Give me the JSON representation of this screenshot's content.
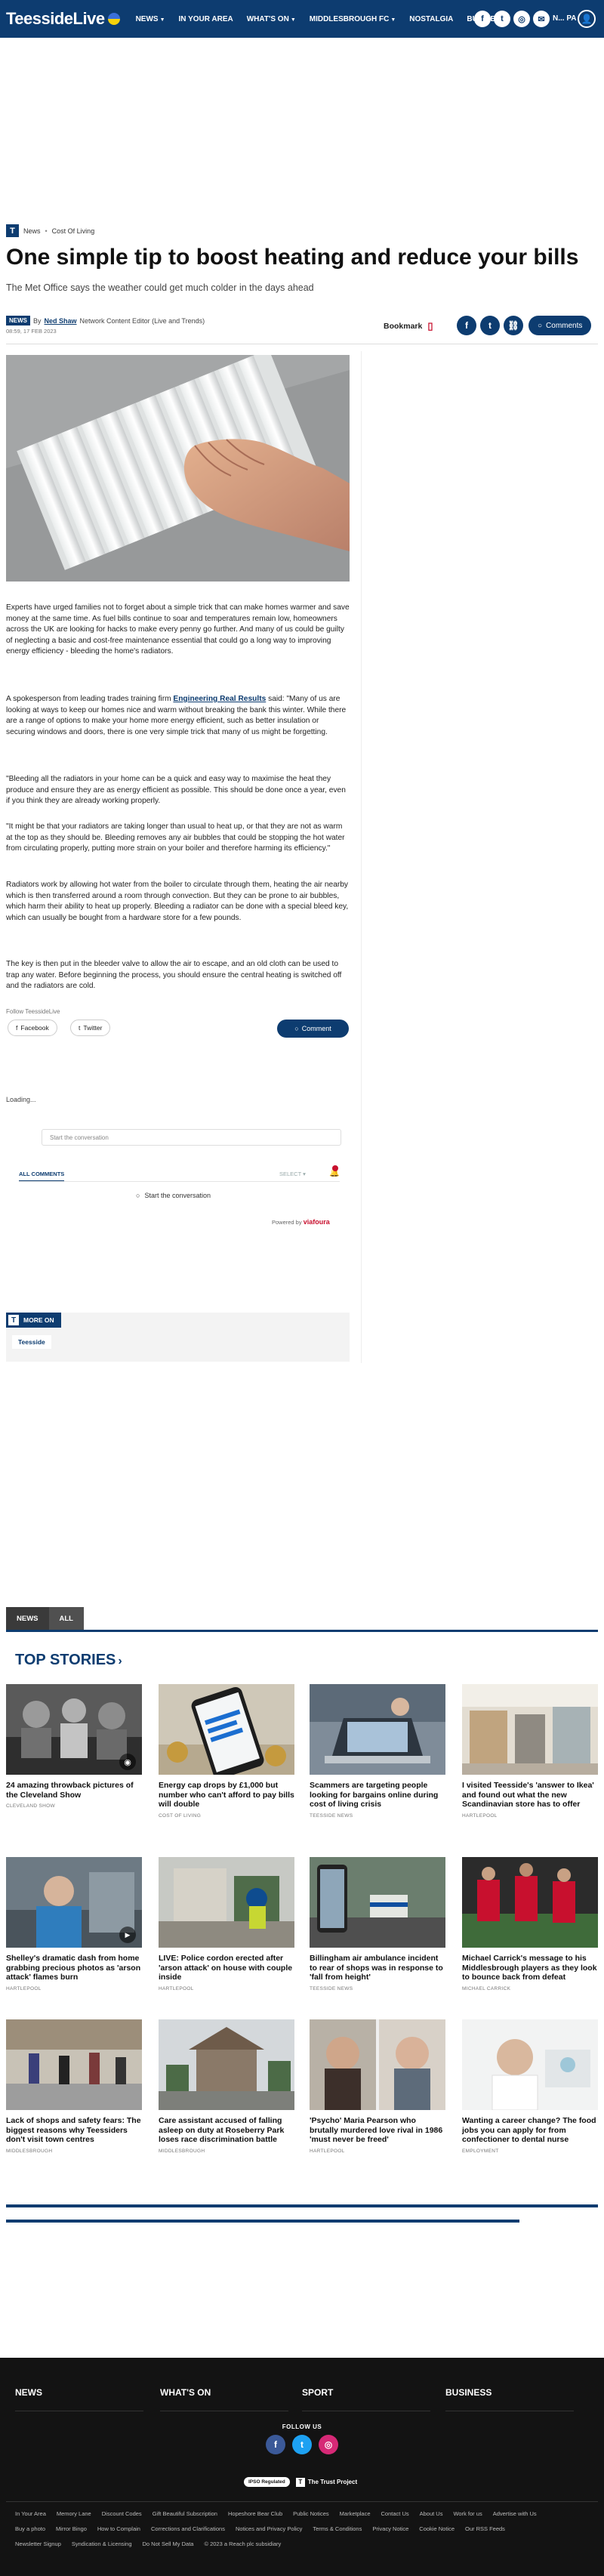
{
  "header": {
    "logo": "TeessideLive",
    "nav": [
      {
        "label": "NEWS",
        "caret": true
      },
      {
        "label": "IN YOUR AREA",
        "caret": false
      },
      {
        "label": "WHAT'S ON",
        "caret": true
      },
      {
        "label": "MIDDLESBROUGH FC",
        "caret": true
      },
      {
        "label": "NOSTALGIA",
        "caret": false
      },
      {
        "label": "BUSINE",
        "caret": false
      }
    ],
    "tail_text": "N... PA",
    "colors": {
      "brand": "#0d3c70",
      "accent": "#c8102e"
    }
  },
  "breadcrumb": {
    "badge": "T",
    "items": [
      "News",
      "Cost Of Living"
    ]
  },
  "article": {
    "title": "One simple tip to boost heating and reduce your bills",
    "subtitle": "The Met Office says the weather could get much colder in the days ahead",
    "byline_tag": "NEWS",
    "by": "By",
    "author": "Ned Shaw",
    "author_role": "Network Content Editor (Live and Trends)",
    "date": "08:59, 17 FEB 2023",
    "bookmark": "Bookmark",
    "comments_label": "Comments",
    "p1": "Experts have urged families not to forget about a simple trick that can make homes warmer and save money at the same time. As fuel bills continue to soar and temperatures remain low, homeowners across the UK are looking for hacks to make every penny go further. And many of us could be guilty of neglecting a basic and cost-free maintenance essential that could go a long way to improving energy efficiency - bleeding the home's radiators.",
    "p2_pre": "A spokesperson from leading trades training firm ",
    "p2_link": "Engineering Real Results",
    "p2_post": " said: \"Many of us are looking at ways to keep our homes nice and warm without breaking the bank this winter. While there are a range of options to make your home more energy efficient, such as better insulation or securing windows and doors, there is one very simple trick that many of us might be forgetting.",
    "p3": "\"Bleeding all the radiators in your home can be a quick and easy way to maximise the heat they produce and ensure they are as energy efficient as possible. This should be done once a year, even if you think they are already working properly.",
    "p4": "\"It might be that your radiators are taking longer than usual to heat up, or that they are not as warm at the top as they should be. Bleeding removes any air bubbles that could be stopping the hot water from circulating properly, putting more strain on your boiler and therefore harming its efficiency.\"",
    "p5": "Radiators work by allowing hot water from the boiler to circulate through them, heating the air nearby which is then transferred around a room through convection. But they can be prone to air bubbles, which harm their ability to heat up properly. Bleeding a radiator can be done with a special bleed key, which can usually be bought from a hardware store for a few pounds.",
    "p6": "The key is then put in the bleeder valve to allow the air to escape, and an old cloth can be used to trap any water. Before beginning the process, you should ensure the central heating is switched off and the radiators are cold.",
    "follow": "Follow TeessideLive",
    "facebook": "Facebook",
    "twitter": "Twitter",
    "comment_btn": "Comment"
  },
  "comments": {
    "loading": "Loading...",
    "input_placeholder": "Start the conversation",
    "all_comments": "ALL COMMENTS",
    "select": "SELECT",
    "start": "Start the conversation",
    "powered_by": "Powered by",
    "provider": "viafoura"
  },
  "more_on": {
    "label": "MORE ON",
    "chip": "Teesside"
  },
  "tabs": [
    "NEWS",
    "ALL"
  ],
  "top_stories": {
    "title": "TOP STORIES",
    "cards": [
      {
        "headline": "24 amazing throwback pictures of the Cleveland Show",
        "category": "CLEVELAND SHOW"
      },
      {
        "headline": "Energy cap drops by £1,000 but number who can't afford to pay bills will double",
        "category": "COST OF LIVING"
      },
      {
        "headline": "Scammers are targeting people looking for bargains online during cost of living crisis",
        "category": "TEESSIDE NEWS"
      },
      {
        "headline": "I visited Teesside's 'answer to Ikea' and found out what the new Scandinavian store has to offer",
        "category": "HARTLEPOOL"
      },
      {
        "headline": "Shelley's dramatic dash from home grabbing precious photos as 'arson attack' flames burn",
        "category": "HARTLEPOOL"
      },
      {
        "headline": "LIVE: Police cordon erected after 'arson attack' on house with couple inside",
        "category": "HARTLEPOOL"
      },
      {
        "headline": "Billingham air ambulance incident to rear of shops was in response to 'fall from height'",
        "category": "TEESSIDE NEWS"
      },
      {
        "headline": "Michael Carrick's message to his Middlesbrough players as they look to bounce back from defeat",
        "category": "MICHAEL CARRICK"
      },
      {
        "headline": "Lack of shops and safety fears: The biggest reasons why Teessiders don't visit town centres",
        "category": "MIDDLESBROUGH"
      },
      {
        "headline": "Care assistant accused of falling asleep on duty at Roseberry Park loses race discrimination battle",
        "category": "MIDDLESBROUGH"
      },
      {
        "headline": "'Psycho' Maria Pearson who brutally murdered love rival in 1986 'must never be freed'",
        "category": "HARTLEPOOL"
      },
      {
        "headline": "Wanting a career change? The food jobs you can apply for from confectioner to dental nurse",
        "category": "EMPLOYMENT"
      }
    ]
  },
  "footer": {
    "cols": [
      "NEWS",
      "WHAT'S ON",
      "SPORT",
      "BUSINESS"
    ],
    "follow_us": "FOLLOW US",
    "ipso": "IPSO Regulated",
    "trust": "The Trust Project",
    "links": [
      "In Your Area",
      "Memory Lane",
      "Discount Codes",
      "Gift Beautiful Subscription",
      "Hopeshore Bear Club",
      "Public Notices",
      "Marketplace",
      "Contact Us",
      "About Us",
      "Work for us",
      "Advertise with Us",
      "Buy a photo",
      "Mirror Bingo",
      "How to Complain",
      "Corrections and Clarifications",
      "Notices and Privacy Policy",
      "Terms & Conditions",
      "Privacy Notice",
      "Cookie Notice",
      "Our RSS Feeds",
      "Newsletter Signup",
      "Syndication & Licensing",
      "Do Not Sell My Data",
      "© 2023 a Reach plc subsidiary"
    ]
  }
}
